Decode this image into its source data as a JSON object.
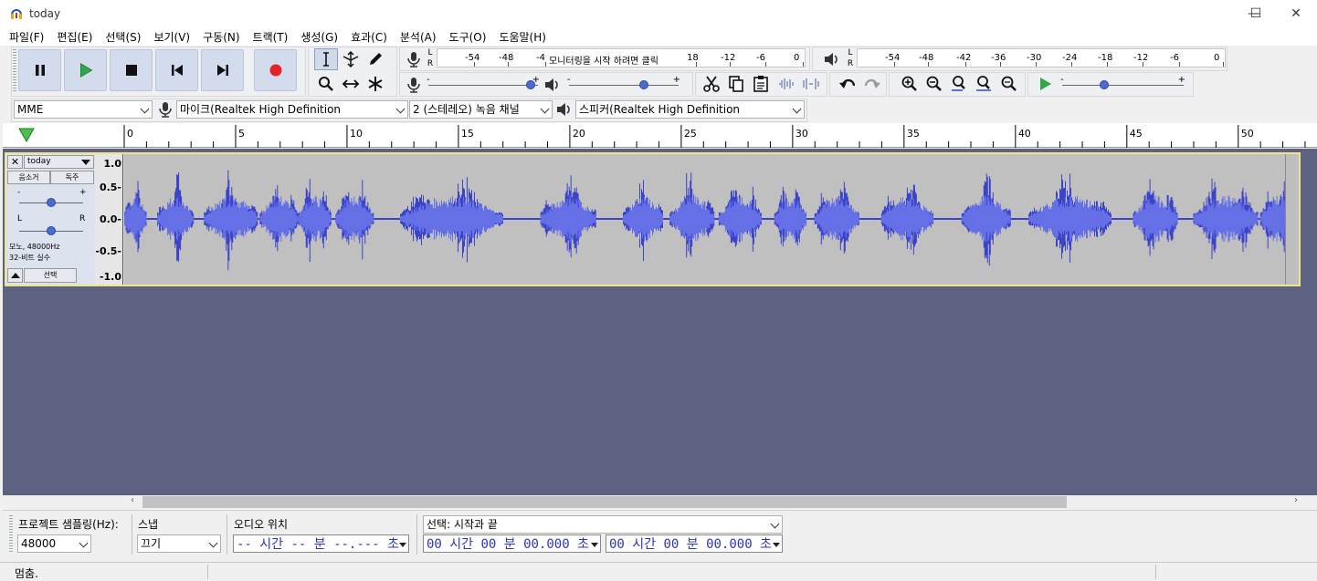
{
  "window": {
    "title": "today",
    "minimize": "—",
    "maximize": "☐",
    "close": "✕"
  },
  "menu": [
    "파일(F)",
    "편집(E)",
    "선택(S)",
    "보기(V)",
    "구동(N)",
    "트랙(T)",
    "생성(G)",
    "효과(C)",
    "분석(A)",
    "도구(O)",
    "도움말(H)"
  ],
  "transport": {
    "icons": [
      "pause-icon",
      "play-icon",
      "stop-icon",
      "skip-start-icon",
      "skip-end-icon",
      "record-icon"
    ]
  },
  "tools": {
    "icons": [
      "selection-tool-icon",
      "envelope-tool-icon",
      "draw-tool-icon",
      "zoom-tool-icon",
      "timeshift-tool-icon",
      "multi-tool-icon"
    ]
  },
  "record_meter": {
    "L": "L",
    "R": "R",
    "ticks": [
      "-54",
      "-48",
      "-4",
      "18",
      "-12",
      "-6",
      "0"
    ],
    "prompt": "모니터링을 시작 하려면 클릭"
  },
  "play_meter": {
    "L": "L",
    "R": "R",
    "ticks": [
      "-54",
      "-48",
      "-42",
      "-36",
      "-30",
      "-24",
      "-18",
      "-12",
      "-6",
      "0"
    ]
  },
  "mixer": {
    "minus": "-",
    "plus": "+",
    "rec_level": 0.97,
    "play_level": 0.7,
    "speed_level": 0.33
  },
  "device": {
    "host": "MME",
    "mic": "마이크(Realtek High Definition",
    "channels": "2 (스테레오) 녹음 채널",
    "speaker": "스피커(Realtek High Definition"
  },
  "ruler": {
    "labels": [
      "0",
      "5",
      "10",
      "15",
      "20",
      "25",
      "30",
      "35",
      "40",
      "45",
      "50"
    ],
    "max_seconds": 53.5
  },
  "track": {
    "name": "today",
    "close": "✕",
    "mute": "음소거",
    "solo": "독주",
    "gain_minus": "-",
    "gain_plus": "+",
    "pan_left": "L",
    "pan_right": "R",
    "gain_level": 0.5,
    "pan_level": 0.5,
    "info1": "모노, 48000Hz",
    "info2": "32-비트 실수",
    "select": "선택",
    "scale": [
      "1.0",
      "0.5-",
      "0.0-",
      "-0.5-",
      "-1.0"
    ],
    "segments": [
      [
        0.0,
        1.0
      ],
      [
        1.5,
        3.1
      ],
      [
        3.6,
        6.0
      ],
      [
        6.1,
        7.8
      ],
      [
        7.8,
        9.3
      ],
      [
        9.5,
        11.2
      ],
      [
        12.4,
        17.0
      ],
      [
        18.7,
        21.2
      ],
      [
        22.4,
        24.2
      ],
      [
        24.5,
        26.5
      ],
      [
        26.7,
        28.6
      ],
      [
        29.2,
        30.6
      ],
      [
        31.0,
        33.0
      ],
      [
        34.0,
        36.3
      ],
      [
        37.6,
        39.8
      ],
      [
        40.6,
        44.3
      ],
      [
        45.3,
        47.3
      ],
      [
        48.0,
        50.9
      ],
      [
        51.0,
        52.5
      ]
    ]
  },
  "selection_bar": {
    "rate_label": "프로젝트 샘플링(Hz):",
    "rate_value": "48000",
    "snap_label": "스냅",
    "snap_value": "끄기",
    "pos_label": "오디오 위치",
    "pos_value": "-- 시간 -- 분 --.--- 초",
    "sel_label": "선택: 시작과 끝",
    "sel_start": "00 시간 00 분 00.000 초",
    "sel_end": "00 시간 00 분 00.000 초"
  },
  "status": {
    "text": "멈춤."
  }
}
